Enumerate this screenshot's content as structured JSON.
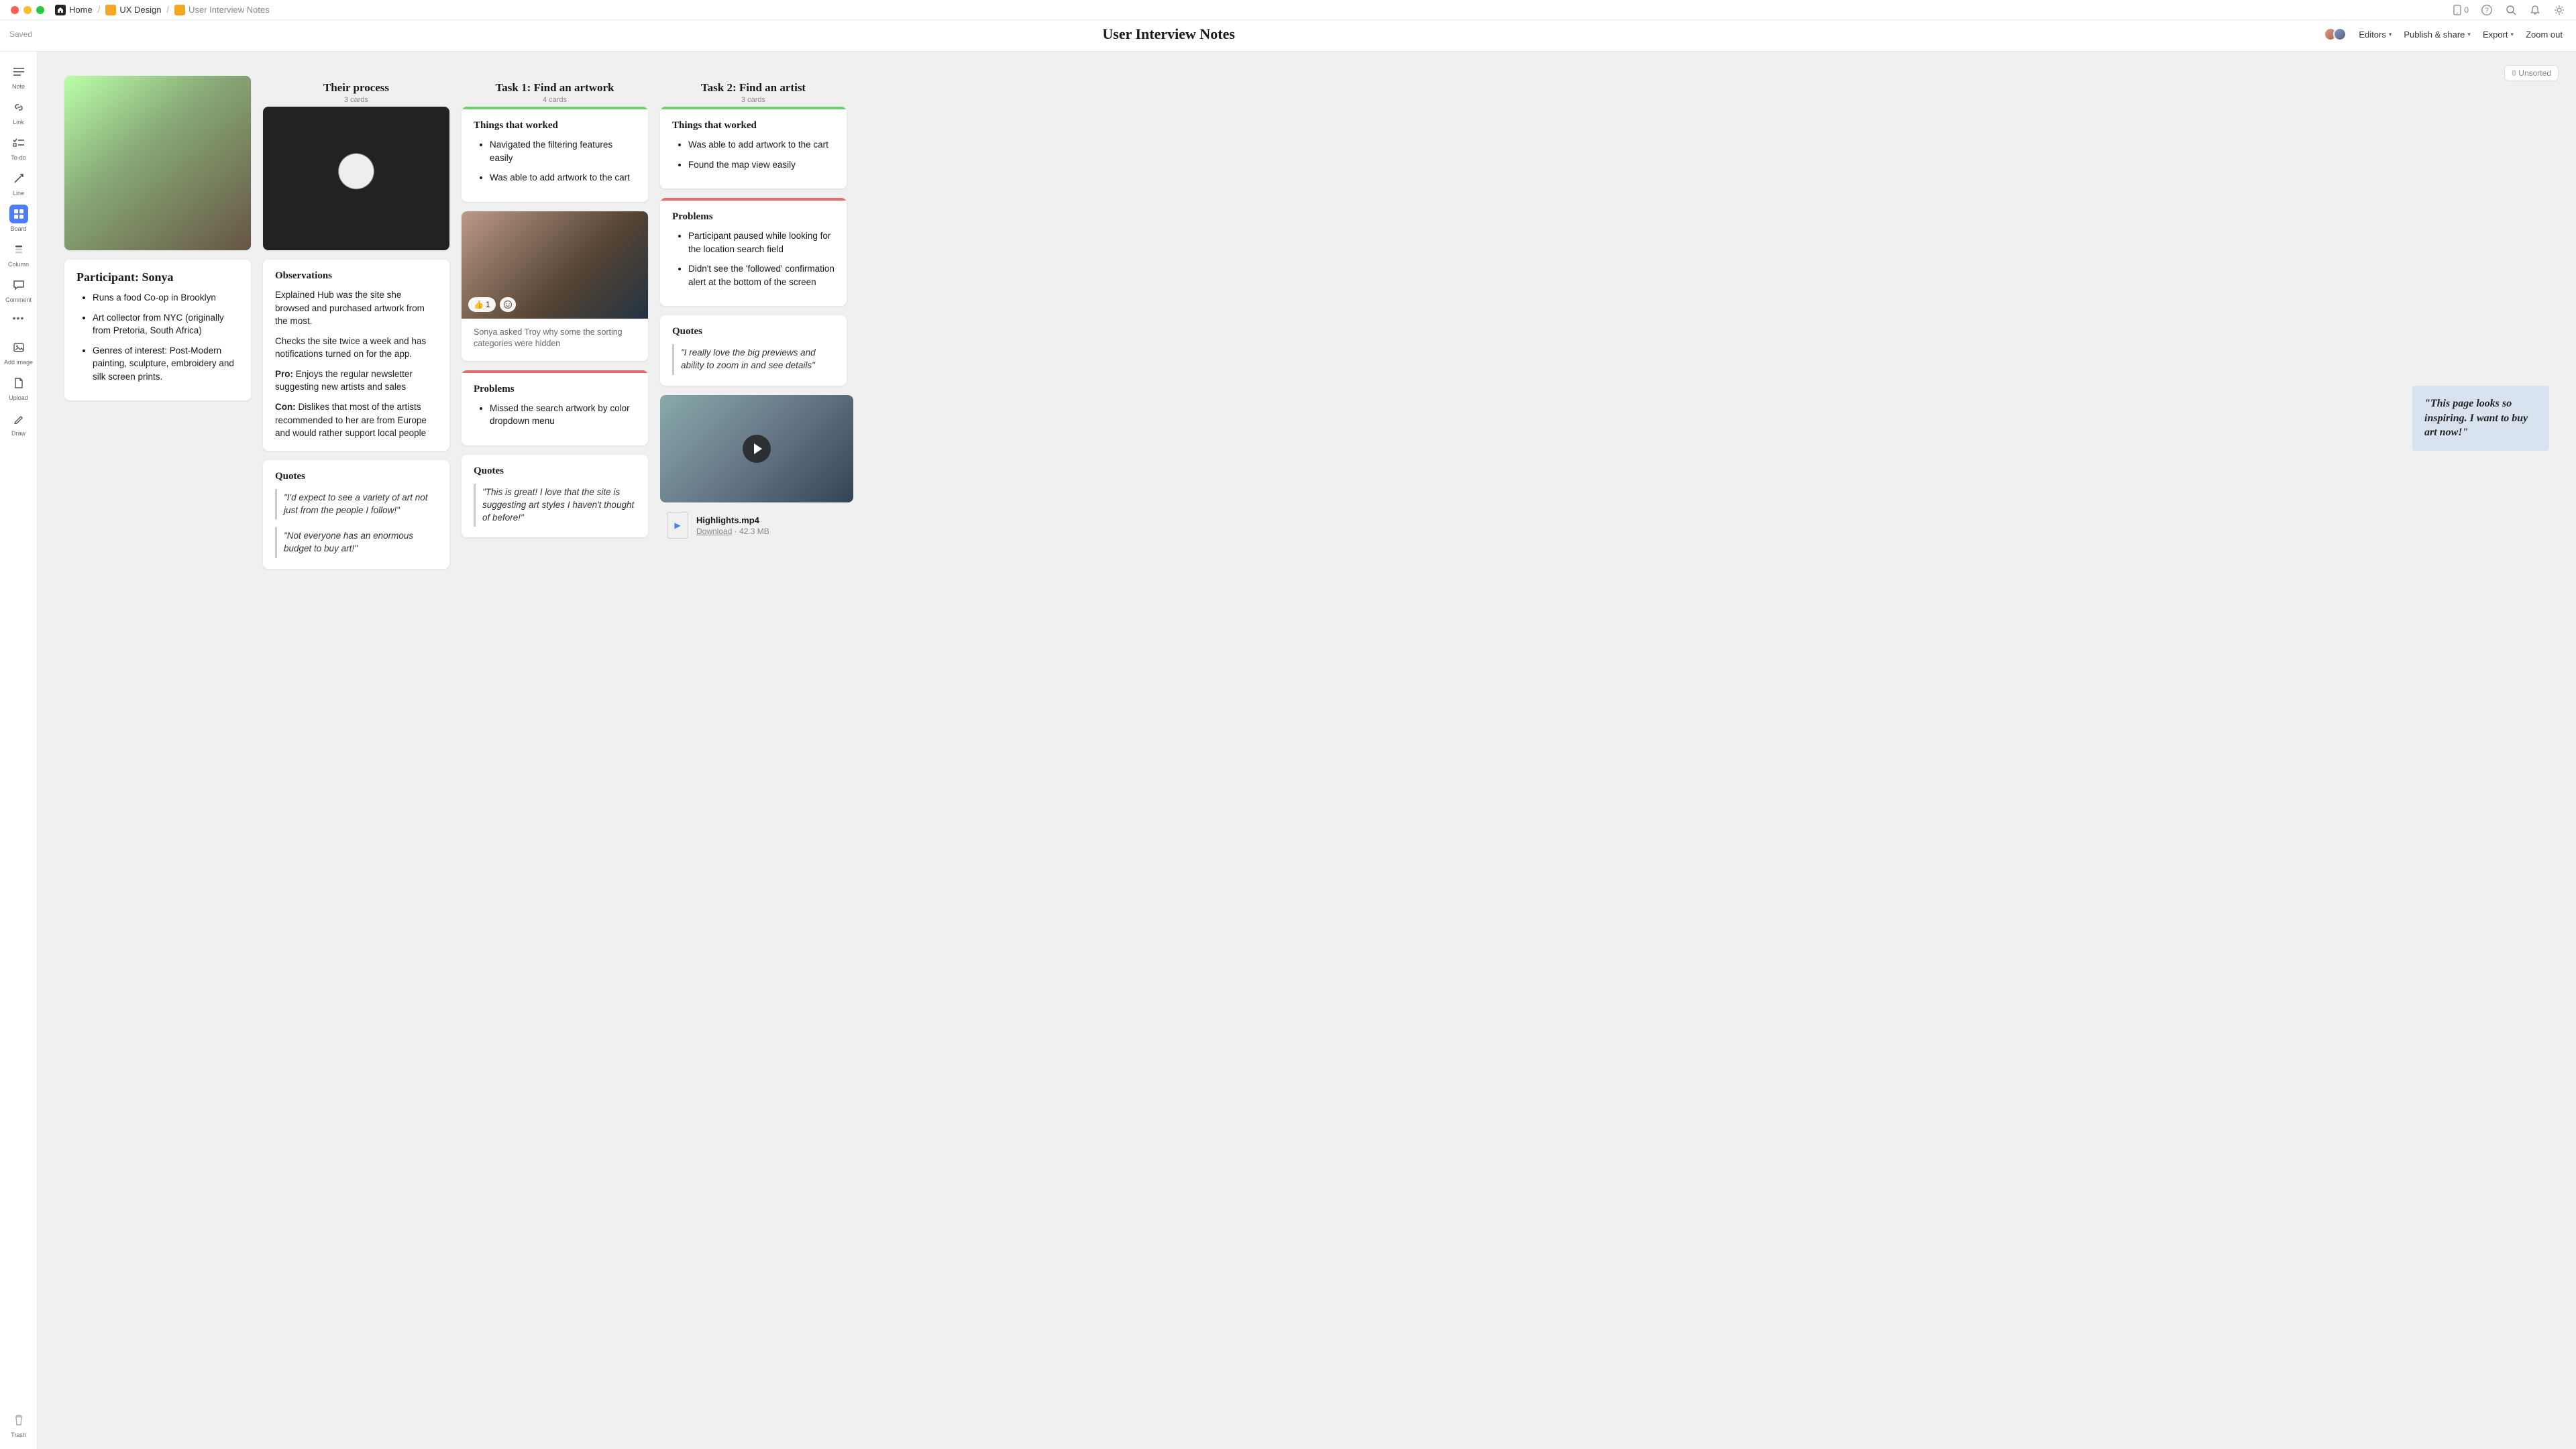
{
  "breadcrumbs": [
    {
      "label": "Home",
      "icon": "home"
    },
    {
      "label": "UX Design",
      "icon": "orange"
    },
    {
      "label": "User Interview Notes",
      "icon": "orange"
    }
  ],
  "titlebar": {
    "phone_count": "0"
  },
  "subheader": {
    "saved": "Saved",
    "page_title": "User Interview Notes",
    "editors_label": "Editors",
    "publish_label": "Publish & share",
    "export_label": "Export",
    "zoom_label": "Zoom out"
  },
  "sidebar": {
    "tools": [
      {
        "id": "note",
        "label": "Note"
      },
      {
        "id": "link",
        "label": "Link"
      },
      {
        "id": "todo",
        "label": "To-do"
      },
      {
        "id": "line",
        "label": "Line"
      },
      {
        "id": "board",
        "label": "Board",
        "active": true
      },
      {
        "id": "column",
        "label": "Column"
      },
      {
        "id": "comment",
        "label": "Comment"
      }
    ],
    "more": "•••",
    "addimage_label": "Add image",
    "upload_label": "Upload",
    "draw_label": "Draw",
    "trash_label": "Trash"
  },
  "unsorted": {
    "count": "0",
    "label": "Unsorted"
  },
  "columns": {
    "col1": {
      "participant_title": "Participant: Sonya",
      "bullets": [
        "Runs a food Co-op in Brooklyn",
        "Art collector from NYC (originally from Pretoria, South Africa)",
        "Genres of interest: Post-Modern painting, sculpture, embroidery and silk screen prints."
      ]
    },
    "col2": {
      "title": "Their process",
      "count": "3 cards",
      "obs_h": "Observations",
      "obs_p1": "Explained Hub was the site she browsed and purchased artwork from the most.",
      "obs_p2": "Checks the site twice a week and has notifications turned on for the app.",
      "pro_label": "Pro:",
      "pro_text": " Enjoys the regular newsletter suggesting new artists and sales",
      "con_label": "Con:",
      "con_text": " Dislikes that most of the artists recommended to her are from Europe and would rather support local people",
      "quotes_h": "Quotes",
      "quote1": "\"I'd expect to see a variety of art not just from the people I follow!\"",
      "quote2": "\"Not everyone has an enormous budget to buy art!\""
    },
    "col3": {
      "title": "Task 1: Find an artwork",
      "count": "4 cards",
      "worked_h": "Things that worked",
      "worked_items": [
        "Navigated the filtering features easily",
        "Was able to add artwork to the cart"
      ],
      "reaction_emoji": "👍",
      "reaction_count": "1",
      "caption": "Sonya asked Troy why some the sorting categories were hidden",
      "problems_h": "Problems",
      "problems_items": [
        "Missed the search artwork by color dropdown menu"
      ],
      "quotes_h": "Quotes",
      "quote1": "\"This is great! I love that the site is suggesting art styles I haven't thought of before!\""
    },
    "col4": {
      "title": "Task 2: Find an artist",
      "count": "3 cards",
      "worked_h": "Things that worked",
      "worked_items": [
        "Was able to add artwork to the cart",
        "Found the map view easily"
      ],
      "problems_h": "Problems",
      "problems_items": [
        "Participant paused while looking for the location search field",
        "Didn't see the 'followed' confirmation alert at the bottom of the screen"
      ],
      "quotes_h": "Quotes",
      "quote1": "\"I really love the big previews and ability to zoom in and see details\"",
      "file_name": "Highlights.mp4",
      "file_download": "Download",
      "file_size": "42.3 MB"
    }
  },
  "float_quote": "\"This page looks so inspiring. I want to buy art now!\""
}
